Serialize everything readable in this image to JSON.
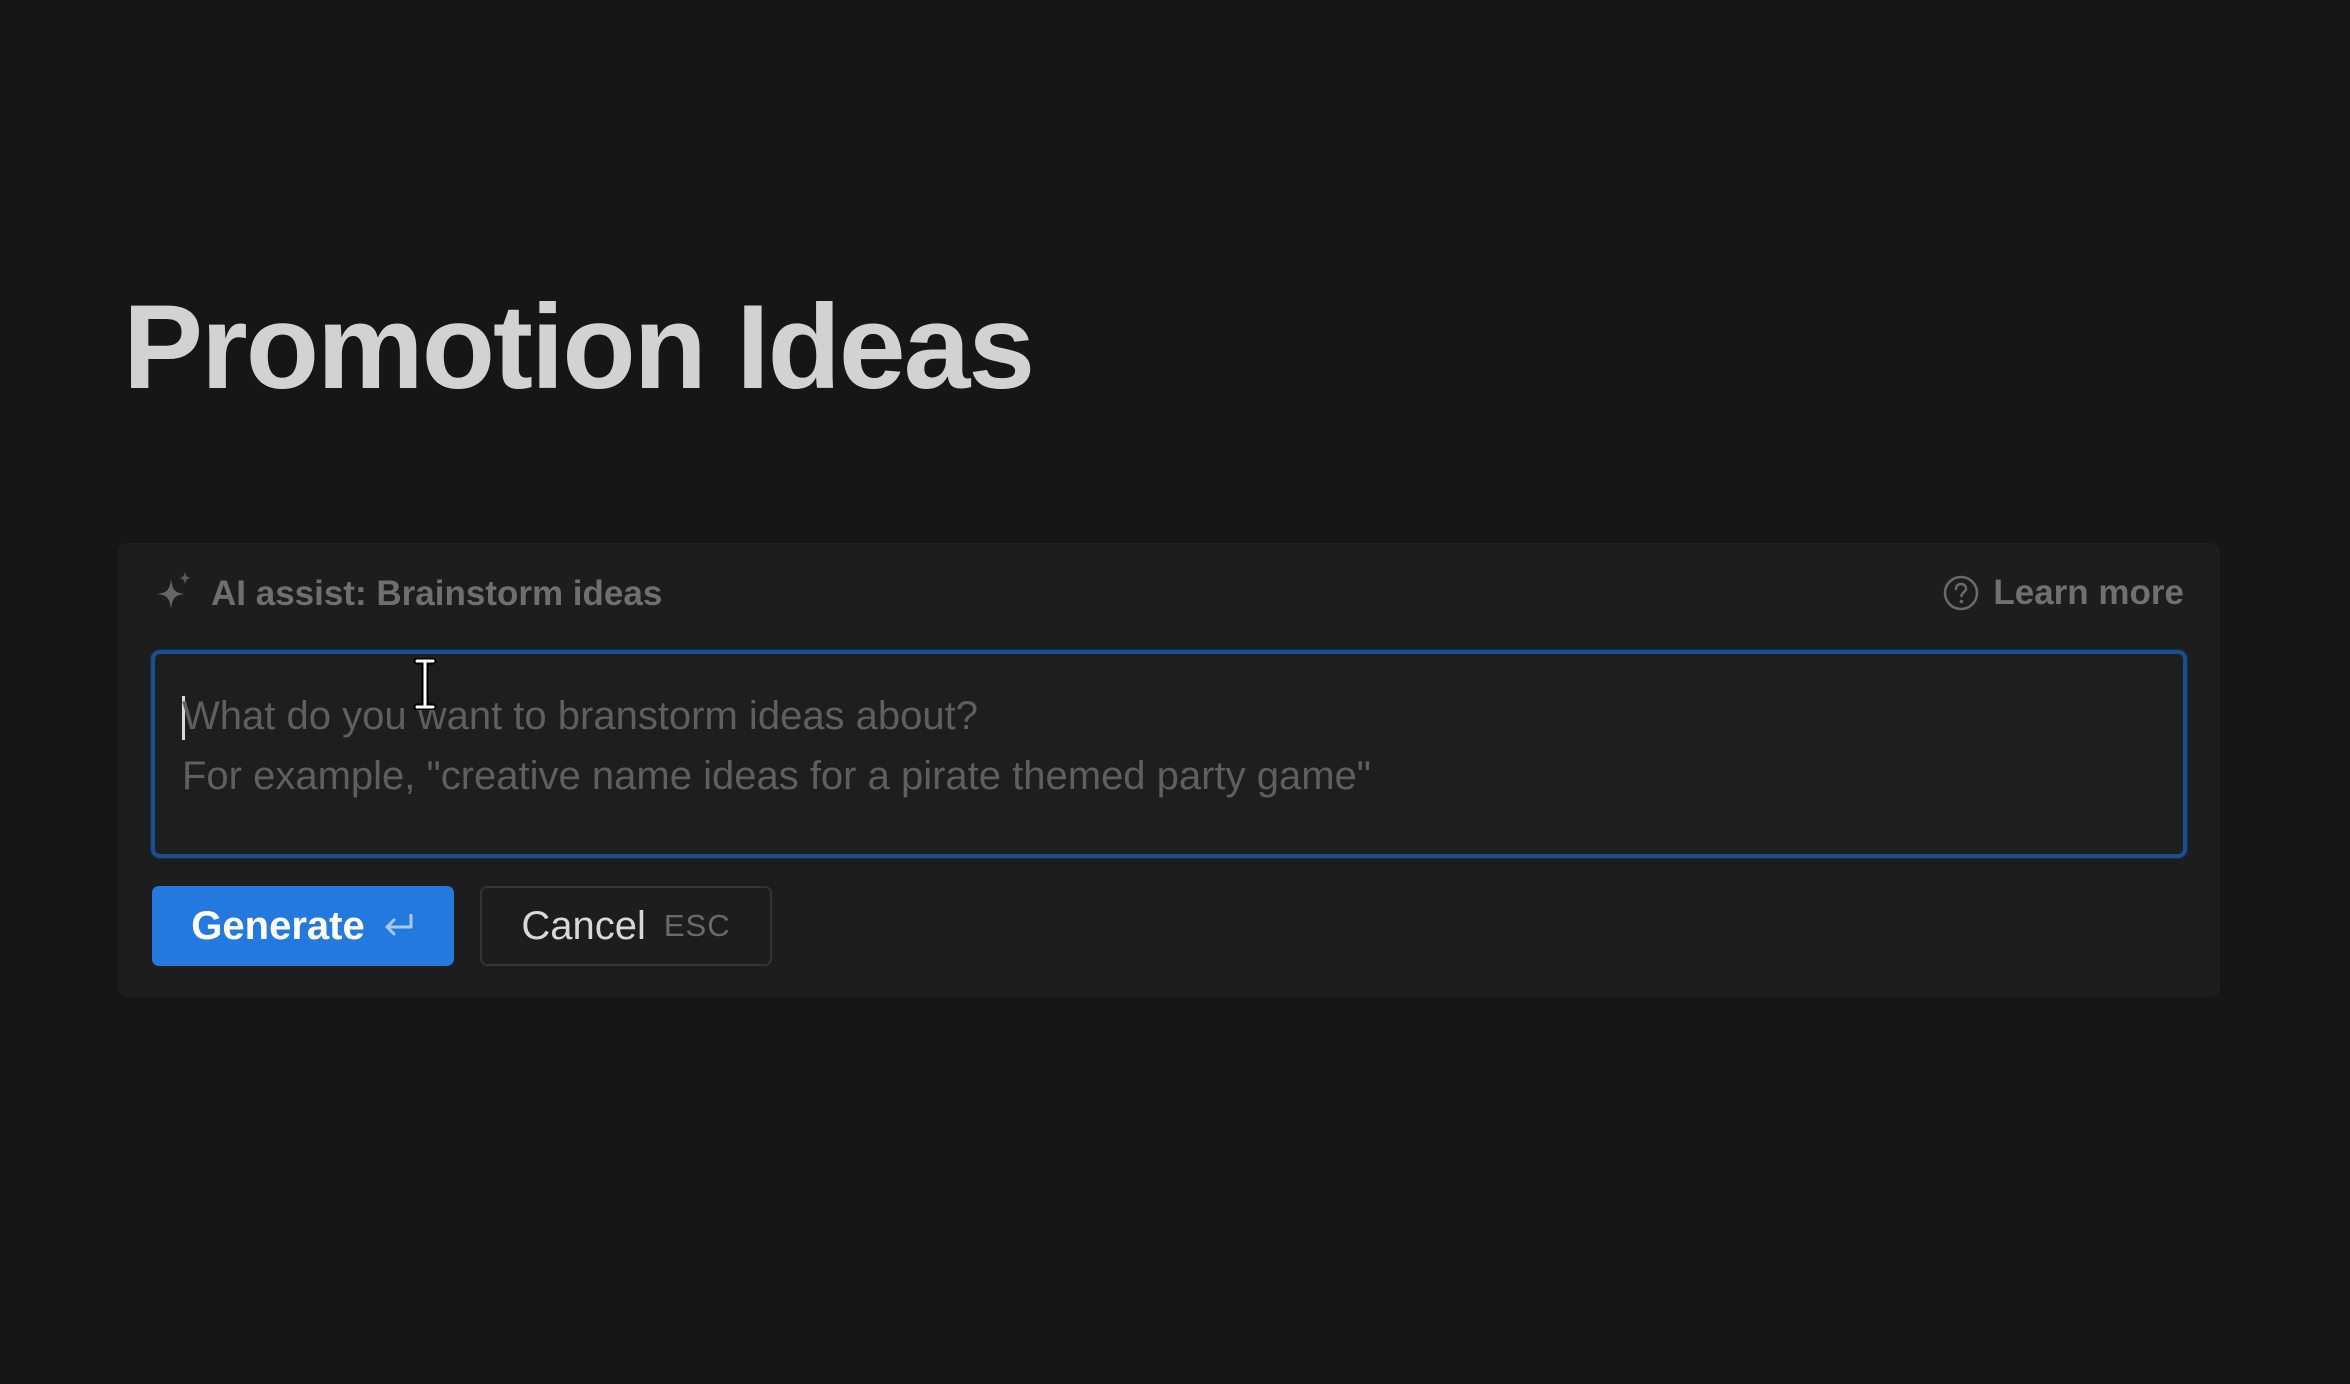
{
  "page": {
    "title": "Promotion Ideas"
  },
  "ai_assist": {
    "icon": "sparkle-icon",
    "prefix": "AI assist:",
    "mode": "Brainstorm ideas",
    "learn_more": {
      "icon": "help-circle-icon",
      "label": "Learn more"
    },
    "prompt": {
      "value": "",
      "placeholder_line_1": "What do you want to branstorm ideas about?",
      "placeholder_line_2": "For example, \"creative name ideas for a pirate themed party game\""
    },
    "generate_button": {
      "label": "Generate",
      "icon": "enter-key-icon",
      "color": "#2479df"
    },
    "cancel_button": {
      "label": "Cancel",
      "shortcut": "ESC"
    }
  }
}
